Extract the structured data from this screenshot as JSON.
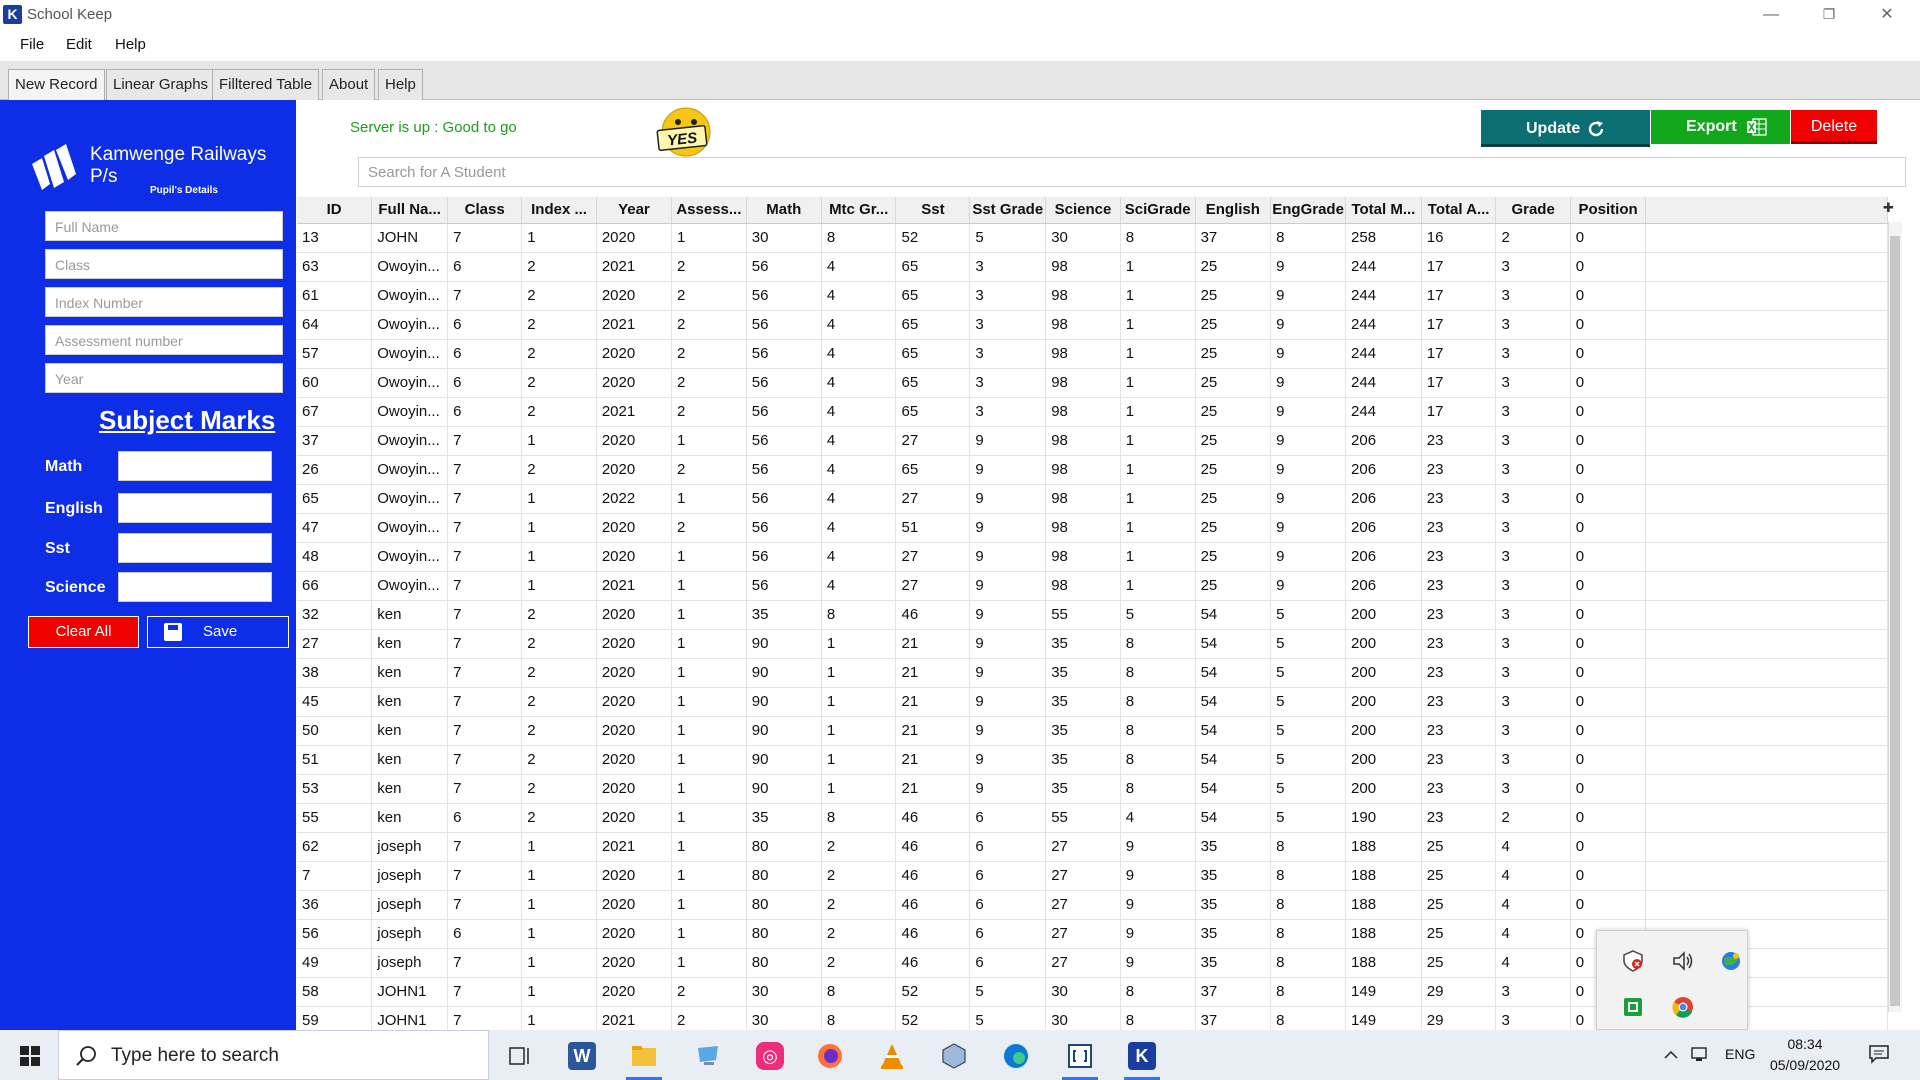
{
  "window": {
    "title": "School Keep",
    "app_icon_letter": "K",
    "minimize": "—",
    "restore": "❐",
    "close": "✕"
  },
  "menu": [
    "File",
    "Edit",
    "Help"
  ],
  "tabs": [
    "New Record",
    "Linear Graphs",
    "Filltered Table",
    "About",
    "Help"
  ],
  "sidebar": {
    "school_name": "Kamwenge Railways P/s",
    "section_title": "Pupil's Details",
    "fields": [
      {
        "placeholder": "Full Name"
      },
      {
        "placeholder": "Class"
      },
      {
        "placeholder": "Index Number"
      },
      {
        "placeholder": "Assessment number"
      },
      {
        "placeholder": "Year"
      }
    ],
    "subject_marks_title": "Subject Marks",
    "marks": [
      "Math",
      "English",
      "Sst",
      "Science"
    ],
    "clear_label": "Clear All",
    "save_label": "Save"
  },
  "header": {
    "server_status": "Server is up : Good to go",
    "emoji_text": "YES",
    "update_label": "Update",
    "export_label": "Export",
    "delete_label": "Delete",
    "search_placeholder": "Search for A Student"
  },
  "table": {
    "columns": [
      "ID",
      "Full Na...",
      "Class",
      "Index ...",
      "Year",
      "Assess...",
      "Math",
      "Mtc Gr...",
      "Sst",
      "Sst Grade",
      "Science",
      "SciGrade",
      "English",
      "EngGrade",
      "Total M...",
      "Total A...",
      "Grade",
      "Position"
    ],
    "rows": [
      [
        "13",
        "JOHN",
        "7",
        "1",
        "2020",
        "1",
        "30",
        "8",
        "52",
        "5",
        "30",
        "8",
        "37",
        "8",
        "258",
        "16",
        "2",
        "0"
      ],
      [
        "63",
        "Owoyin...",
        "6",
        "2",
        "2021",
        "2",
        "56",
        "4",
        "65",
        "3",
        "98",
        "1",
        "25",
        "9",
        "244",
        "17",
        "3",
        "0"
      ],
      [
        "61",
        "Owoyin...",
        "7",
        "2",
        "2020",
        "2",
        "56",
        "4",
        "65",
        "3",
        "98",
        "1",
        "25",
        "9",
        "244",
        "17",
        "3",
        "0"
      ],
      [
        "64",
        "Owoyin...",
        "6",
        "2",
        "2021",
        "2",
        "56",
        "4",
        "65",
        "3",
        "98",
        "1",
        "25",
        "9",
        "244",
        "17",
        "3",
        "0"
      ],
      [
        "57",
        "Owoyin...",
        "6",
        "2",
        "2020",
        "2",
        "56",
        "4",
        "65",
        "3",
        "98",
        "1",
        "25",
        "9",
        "244",
        "17",
        "3",
        "0"
      ],
      [
        "60",
        "Owoyin...",
        "6",
        "2",
        "2020",
        "2",
        "56",
        "4",
        "65",
        "3",
        "98",
        "1",
        "25",
        "9",
        "244",
        "17",
        "3",
        "0"
      ],
      [
        "67",
        "Owoyin...",
        "6",
        "2",
        "2021",
        "2",
        "56",
        "4",
        "65",
        "3",
        "98",
        "1",
        "25",
        "9",
        "244",
        "17",
        "3",
        "0"
      ],
      [
        "37",
        "Owoyin...",
        "7",
        "1",
        "2020",
        "1",
        "56",
        "4",
        "27",
        "9",
        "98",
        "1",
        "25",
        "9",
        "206",
        "23",
        "3",
        "0"
      ],
      [
        "26",
        "Owoyin...",
        "7",
        "2",
        "2020",
        "2",
        "56",
        "4",
        "65",
        "9",
        "98",
        "1",
        "25",
        "9",
        "206",
        "23",
        "3",
        "0"
      ],
      [
        "65",
        "Owoyin...",
        "7",
        "1",
        "2022",
        "1",
        "56",
        "4",
        "27",
        "9",
        "98",
        "1",
        "25",
        "9",
        "206",
        "23",
        "3",
        "0"
      ],
      [
        "47",
        "Owoyin...",
        "7",
        "1",
        "2020",
        "2",
        "56",
        "4",
        "51",
        "9",
        "98",
        "1",
        "25",
        "9",
        "206",
        "23",
        "3",
        "0"
      ],
      [
        "48",
        "Owoyin...",
        "7",
        "1",
        "2020",
        "1",
        "56",
        "4",
        "27",
        "9",
        "98",
        "1",
        "25",
        "9",
        "206",
        "23",
        "3",
        "0"
      ],
      [
        "66",
        "Owoyin...",
        "7",
        "1",
        "2021",
        "1",
        "56",
        "4",
        "27",
        "9",
        "98",
        "1",
        "25",
        "9",
        "206",
        "23",
        "3",
        "0"
      ],
      [
        "32",
        "ken",
        "7",
        "2",
        "2020",
        "1",
        "35",
        "8",
        "46",
        "9",
        "55",
        "5",
        "54",
        "5",
        "200",
        "23",
        "3",
        "0"
      ],
      [
        "27",
        "ken",
        "7",
        "2",
        "2020",
        "1",
        "90",
        "1",
        "21",
        "9",
        "35",
        "8",
        "54",
        "5",
        "200",
        "23",
        "3",
        "0"
      ],
      [
        "38",
        "ken",
        "7",
        "2",
        "2020",
        "1",
        "90",
        "1",
        "21",
        "9",
        "35",
        "8",
        "54",
        "5",
        "200",
        "23",
        "3",
        "0"
      ],
      [
        "45",
        "ken",
        "7",
        "2",
        "2020",
        "1",
        "90",
        "1",
        "21",
        "9",
        "35",
        "8",
        "54",
        "5",
        "200",
        "23",
        "3",
        "0"
      ],
      [
        "50",
        "ken",
        "7",
        "2",
        "2020",
        "1",
        "90",
        "1",
        "21",
        "9",
        "35",
        "8",
        "54",
        "5",
        "200",
        "23",
        "3",
        "0"
      ],
      [
        "51",
        "ken",
        "7",
        "2",
        "2020",
        "1",
        "90",
        "1",
        "21",
        "9",
        "35",
        "8",
        "54",
        "5",
        "200",
        "23",
        "3",
        "0"
      ],
      [
        "53",
        "ken",
        "7",
        "2",
        "2020",
        "1",
        "90",
        "1",
        "21",
        "9",
        "35",
        "8",
        "54",
        "5",
        "200",
        "23",
        "3",
        "0"
      ],
      [
        "55",
        "ken",
        "6",
        "2",
        "2020",
        "1",
        "35",
        "8",
        "46",
        "6",
        "55",
        "4",
        "54",
        "5",
        "190",
        "23",
        "2",
        "0"
      ],
      [
        "62",
        " joseph",
        "7",
        "1",
        "2021",
        "1",
        "80",
        "2",
        "46",
        "6",
        "27",
        "9",
        "35",
        "8",
        "188",
        "25",
        "4",
        "0"
      ],
      [
        "7",
        " joseph",
        "7",
        "1",
        "2020",
        "1",
        "80",
        "2",
        "46",
        "6",
        "27",
        "9",
        "35",
        "8",
        "188",
        "25",
        "4",
        "0"
      ],
      [
        "36",
        " joseph",
        "7",
        "1",
        "2020",
        "1",
        "80",
        "2",
        "46",
        "6",
        "27",
        "9",
        "35",
        "8",
        "188",
        "25",
        "4",
        "0"
      ],
      [
        "56",
        " joseph",
        "6",
        "1",
        "2020",
        "1",
        "80",
        "2",
        "46",
        "6",
        "27",
        "9",
        "35",
        "8",
        "188",
        "25",
        "4",
        "0"
      ],
      [
        "49",
        " joseph",
        "7",
        "1",
        "2020",
        "1",
        "80",
        "2",
        "46",
        "6",
        "27",
        "9",
        "35",
        "8",
        "188",
        "25",
        "4",
        "0"
      ],
      [
        "58",
        "JOHN1",
        "7",
        "1",
        "2020",
        "2",
        "30",
        "8",
        "52",
        "5",
        "30",
        "8",
        "37",
        "8",
        "149",
        "29",
        "3",
        "0"
      ],
      [
        "59",
        "JOHN1",
        "7",
        "1",
        "2021",
        "2",
        "30",
        "8",
        "52",
        "5",
        "30",
        "8",
        "37",
        "8",
        "149",
        "29",
        "3",
        "0"
      ]
    ]
  },
  "taskbar": {
    "search_label": "Type here to search",
    "language": "ENG",
    "time": "08:34",
    "date": "05/09/2020"
  },
  "colors": {
    "sidebar": "#0d2de6",
    "update": "#0b6e70",
    "export": "#11a81c",
    "delete": "#f00000",
    "server_status": "#1b9e1b"
  }
}
